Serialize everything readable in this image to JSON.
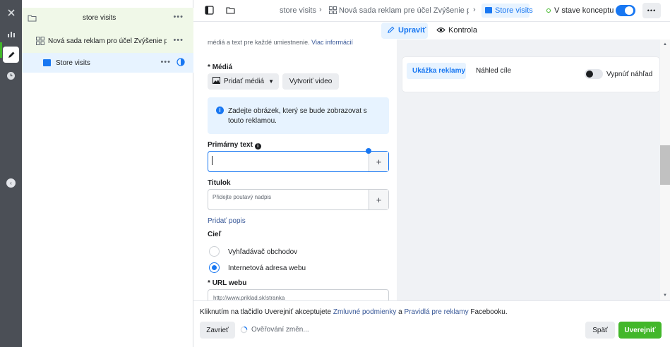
{
  "tree": {
    "campaign": {
      "label": "store visits"
    },
    "adset": {
      "label": "Nová sada reklam pro účel Zvýšenie p..."
    },
    "ad": {
      "label": "Store visits"
    }
  },
  "breadcrumbs": {
    "campaign": "store visits",
    "adset": "Nová sada reklam pre účel Zvýšenie povedo",
    "ad": "Store visits"
  },
  "status": {
    "label": "V stave konceptu",
    "toggle_on": true
  },
  "tabs": {
    "edit": "Upraviť",
    "review": "Kontrola"
  },
  "form": {
    "cutoff_text": "médiá a text pre každé umiestnenie.",
    "cutoff_link": "Viac informácií",
    "media_label": "Médiá",
    "media_required": "*",
    "add_media": "Pridať médiá",
    "create_video": "Vytvoriť video",
    "info_text": "Zadejte obrázek, který se bude zobrazovat s touto reklamou.",
    "primary_text_label": "Primárny text",
    "primary_text_value": "",
    "headline_label": "Titulok",
    "headline_placeholder": "Přidejte poutavý nadpis",
    "add_description": "Pridať popis",
    "destination_label": "Cieľ",
    "destination_options": [
      {
        "label": "Vyhľadávač obchodov",
        "selected": false
      },
      {
        "label": "Internetová adresa webu",
        "selected": true
      }
    ],
    "url_label": "URL webu",
    "url_placeholder": "http://www.priklad.sk/stranka"
  },
  "preview": {
    "tab_active": "Ukážka reklamy",
    "tab_other": "Náhled cíle",
    "toggle_label": "Vypnúť náhľad"
  },
  "footer": {
    "terms_prefix": "Kliknutím na tlačidlo Uverejniť akceptujete ",
    "terms_link1": "Zmluvné podmienky",
    "terms_mid": " a ",
    "terms_link2": "Pravidlá pre reklamy",
    "terms_suffix": " Facebooku.",
    "close": "Zavrieť",
    "verifying": "Ověřování změn...",
    "back": "Späť",
    "publish": "Uverejniť"
  },
  "colors": {
    "accent": "#1877f2",
    "publish": "#42b72a",
    "rail": "#4b4f56"
  }
}
